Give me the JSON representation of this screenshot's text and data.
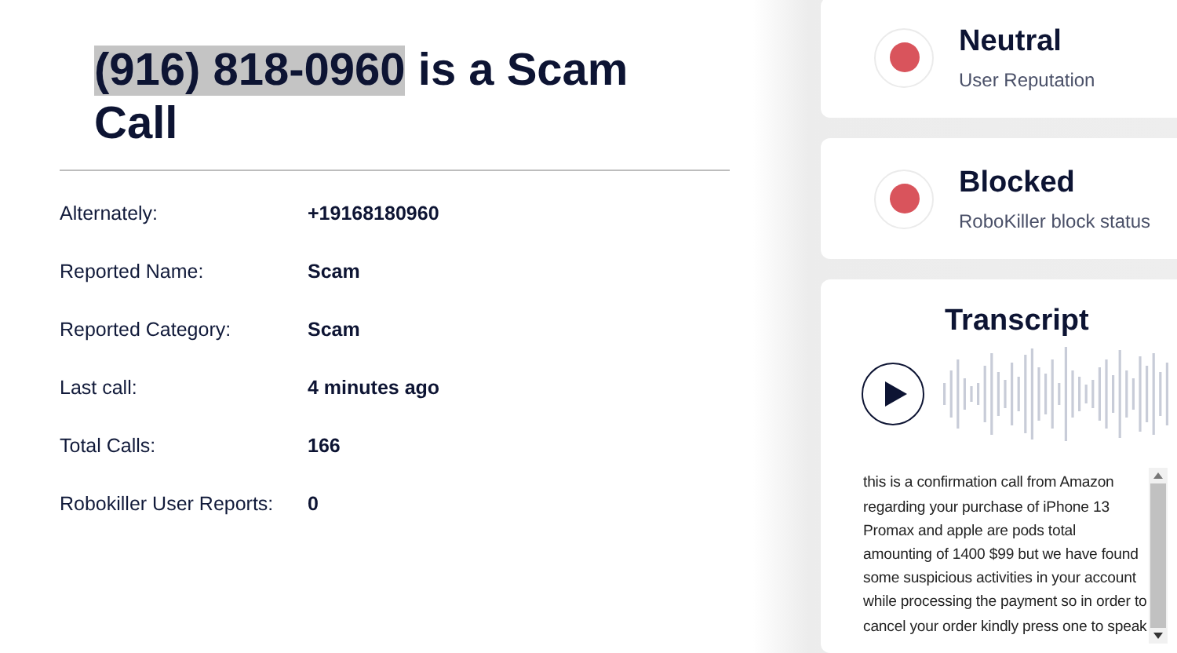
{
  "title": {
    "highlighted": "(916) 818-0960",
    "rest": "is a Scam Call"
  },
  "details": [
    {
      "label": "Alternately:",
      "value": "+19168180960"
    },
    {
      "label": "Reported Name:",
      "value": "Scam"
    },
    {
      "label": "Reported Category:",
      "value": "Scam"
    },
    {
      "label": "Last call:",
      "value": "4 minutes ago"
    },
    {
      "label": "Total Calls:",
      "value": "166"
    },
    {
      "label": "Robokiller User Reports:",
      "value": "0"
    }
  ],
  "status_cards": [
    {
      "heading": "Neutral",
      "caption": "User Reputation",
      "color": "#d9545c"
    },
    {
      "heading": "Blocked",
      "caption": "RoboKiller block status",
      "color": "#d9545c"
    }
  ],
  "transcript": {
    "heading": "Transcript",
    "text": "this is a confirmation call from Amazon regarding your purchase of iPhone 13 Promax and apple are pods total amounting of 1400 $99 but we have found some suspicious activities in your account while processing the payment so in order to cancel your order kindly press one to speak"
  }
}
